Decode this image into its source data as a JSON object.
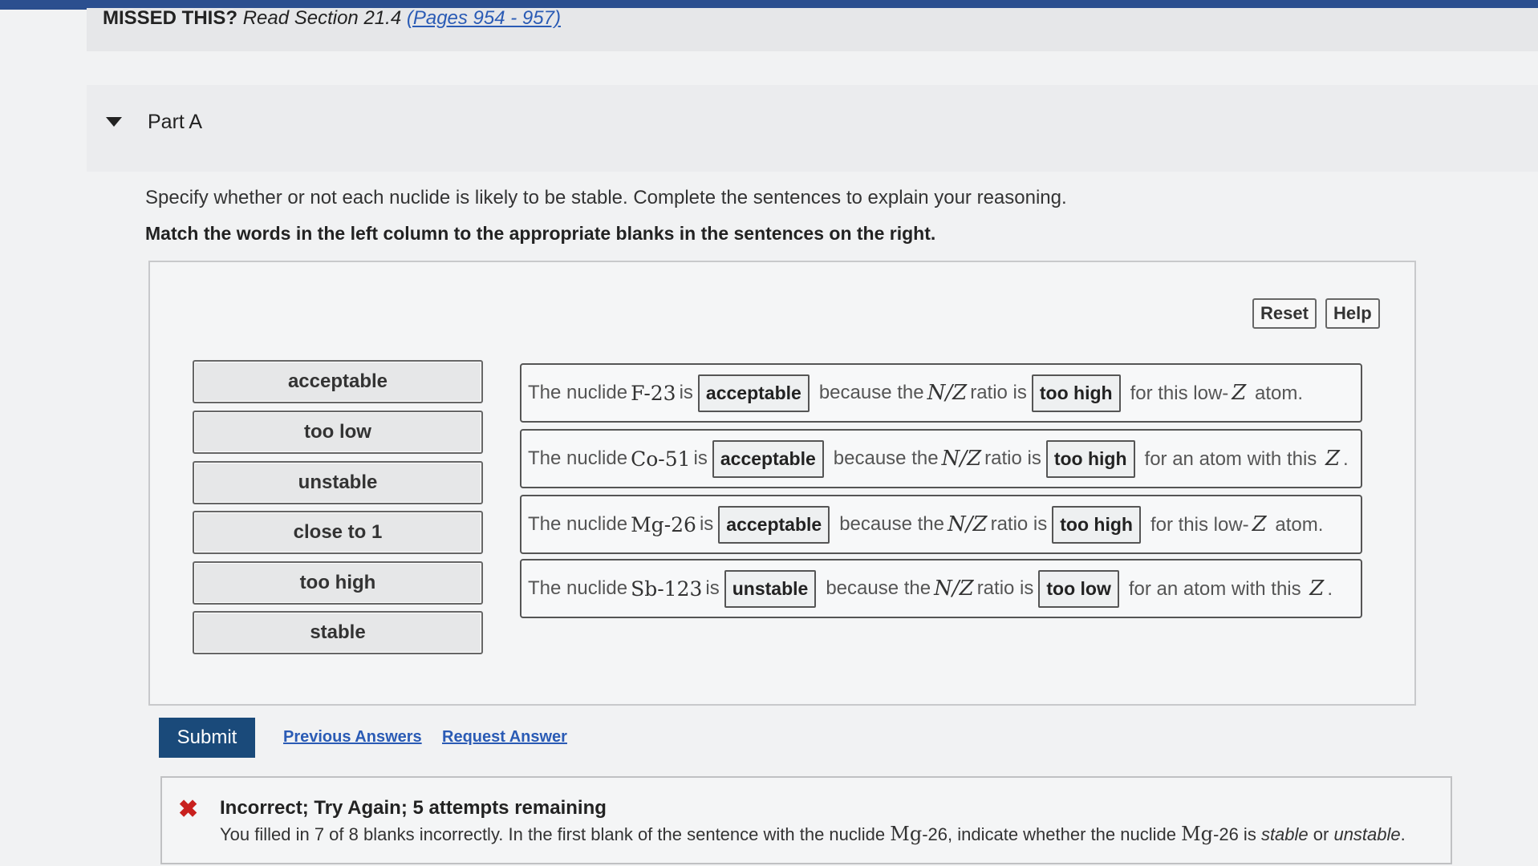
{
  "missed": {
    "label": "MISSED THIS?",
    "text": "Read Section 21.4",
    "link": "(Pages 954 - 957)"
  },
  "part": {
    "title": "Part A"
  },
  "instructions": {
    "line1": "Specify whether or not each nuclide is likely to be stable. Complete the sentences to explain your reasoning.",
    "line2": "Match the words in the left column to the appropriate blanks in the sentences on the right."
  },
  "buttons": {
    "reset": "Reset",
    "help": "Help",
    "submit": "Submit"
  },
  "word_bank": [
    "acceptable",
    "too low",
    "unstable",
    "close to 1",
    "too high",
    "stable"
  ],
  "sentences": [
    {
      "prefix": "The nuclide",
      "nuclide_symbol": "F",
      "nuclide_mass": "-23",
      "is": "is",
      "blank1": "acceptable",
      "because": "because the",
      "ratio_n": "N",
      "ratio_slash": "/",
      "ratio_z": "Z",
      "ratio_is": "ratio is",
      "blank2": "too high",
      "suffix_pre": "for this low-",
      "suffix_z": "Z",
      "suffix_post": " atom."
    },
    {
      "prefix": "The nuclide",
      "nuclide_symbol": "Co",
      "nuclide_mass": "-51",
      "is": "is",
      "blank1": "acceptable",
      "because": "because the",
      "ratio_n": "N",
      "ratio_slash": "/",
      "ratio_z": "Z",
      "ratio_is": "ratio is",
      "blank2": "too high",
      "suffix_pre": "for an atom with this ",
      "suffix_z": "Z",
      "suffix_post": "."
    },
    {
      "prefix": "The nuclide",
      "nuclide_symbol": "Mg",
      "nuclide_mass": "-26",
      "is": "is",
      "blank1": "acceptable",
      "because": "because the",
      "ratio_n": "N",
      "ratio_slash": "/",
      "ratio_z": "Z",
      "ratio_is": "ratio is",
      "blank2": "too high",
      "suffix_pre": "for this low-",
      "suffix_z": "Z",
      "suffix_post": " atom."
    },
    {
      "prefix": "The nuclide",
      "nuclide_symbol": "Sb",
      "nuclide_mass": "-123",
      "is": "is",
      "blank1": "unstable",
      "because": "because the",
      "ratio_n": "N",
      "ratio_slash": "/",
      "ratio_z": "Z",
      "ratio_is": "ratio is",
      "blank2": "too low",
      "suffix_pre": "for an atom with this ",
      "suffix_z": "Z",
      "suffix_post": "."
    }
  ],
  "links": {
    "previous": "Previous Answers",
    "request": "Request Answer"
  },
  "feedback": {
    "icon": "x-icon",
    "title": "Incorrect; Try Again; 5 attempts remaining",
    "msg_a": "You filled in 7 of 8 blanks incorrectly. In the first blank of the sentence with the nuclide ",
    "msg_nuclide1": "Mg",
    "msg_b": "-26, indicate whether the nuclide ",
    "msg_nuclide2": "Mg",
    "msg_c": "-26 is ",
    "msg_stable": "stable",
    "msg_or": " or ",
    "msg_unstable": "unstable",
    "msg_end": "."
  },
  "colors": {
    "submit_bg": "#1a4a7a",
    "link": "#2a5bb5",
    "error": "#c8201e",
    "topbar": "#2b4f8f"
  }
}
